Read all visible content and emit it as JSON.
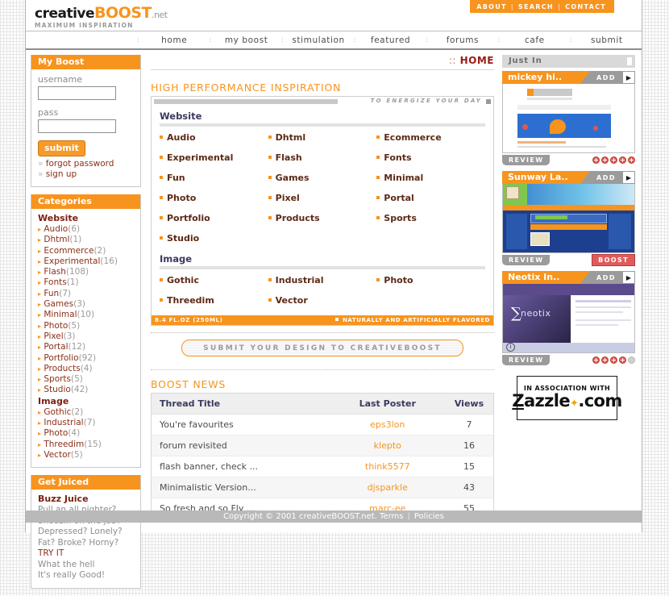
{
  "site": {
    "logo_main": "creative",
    "logo_accent": "BOOST",
    "logo_tld": ".net",
    "logo_sub": "MAXIMUM INSPIRATION"
  },
  "topnav": {
    "items": [
      "ABOUT",
      "SEARCH",
      "CONTACT"
    ],
    "separator": "|"
  },
  "mainnav": {
    "items": [
      "home",
      "my boost",
      "stimulation",
      "featured",
      "forums",
      "cafe",
      "submit"
    ],
    "separator": ":"
  },
  "breadcrumb": {
    "dots": "::",
    "label": "HOME"
  },
  "login_panel": {
    "title": "My Boost",
    "username_label": "username",
    "username_value": "",
    "username_placeholder": "",
    "pass_label": "pass",
    "pass_value": "",
    "pass_placeholder": "",
    "submit_label": "submit",
    "links": [
      {
        "chev": "»",
        "label": "forgot password"
      },
      {
        "chev": "»",
        "label": "sign up"
      }
    ]
  },
  "categories_panel": {
    "title": "Categories",
    "groups": [
      {
        "name": "Website",
        "items": [
          {
            "label": "Audio",
            "count": "(6)"
          },
          {
            "label": "Dhtml",
            "count": "(1)"
          },
          {
            "label": "Ecommerce",
            "count": "(2)"
          },
          {
            "label": "Experimental",
            "count": "(16)"
          },
          {
            "label": "Flash",
            "count": "(108)"
          },
          {
            "label": "Fonts",
            "count": "(1)"
          },
          {
            "label": "Fun",
            "count": "(7)"
          },
          {
            "label": "Games",
            "count": "(3)"
          },
          {
            "label": "Minimal",
            "count": "(10)"
          },
          {
            "label": "Photo",
            "count": "(5)"
          },
          {
            "label": "Pixel",
            "count": "(3)"
          },
          {
            "label": "Portal",
            "count": "(12)"
          },
          {
            "label": "Portfolio",
            "count": "(92)"
          },
          {
            "label": "Products",
            "count": "(4)"
          },
          {
            "label": "Sports",
            "count": "(5)"
          },
          {
            "label": "Studio",
            "count": "(42)"
          }
        ]
      },
      {
        "name": "Image",
        "items": [
          {
            "label": "Gothic",
            "count": "(2)"
          },
          {
            "label": "Industrial",
            "count": "(7)"
          },
          {
            "label": "Photo",
            "count": "(4)"
          },
          {
            "label": "Threedim",
            "count": "(15)"
          },
          {
            "label": "Vector",
            "count": "(5)"
          }
        ]
      }
    ]
  },
  "juiced_panel": {
    "title": "Get Juiced",
    "brand": "Buzz Juice",
    "lines": [
      "Pull an all nighter?",
      "Snoozin on the job?",
      "Depressed? Lonely?",
      "Fat? Broke? Horny?"
    ],
    "cta": "TRY IT",
    "tail": [
      "What the hell",
      "It's really Good!"
    ]
  },
  "inspiration": {
    "heading": "HIGH PERFORMANCE INSPIRATION",
    "tagline": "TO ENERGIZE YOUR DAY",
    "footer_left": "8.4 FL.OZ (250ML)",
    "footer_right": "NATURALLY AND ARTIFICIALLY FLAVORED",
    "groups": [
      {
        "name": "Website",
        "items": [
          "Audio",
          "Dhtml",
          "Ecommerce",
          "Experimental",
          "Flash",
          "Fonts",
          "Fun",
          "Games",
          "Minimal",
          "Photo",
          "Pixel",
          "Portal",
          "Portfolio",
          "Products",
          "Sports",
          "Studio"
        ]
      },
      {
        "name": "Image",
        "items": [
          "Gothic",
          "Industrial",
          "Photo",
          "Threedim",
          "Vector"
        ]
      }
    ]
  },
  "submit_pill": {
    "label": "SUBMIT YOUR DESIGN TO CREATIVEBOOST"
  },
  "news": {
    "heading": "BOOST NEWS",
    "columns": [
      "Thread Title",
      "Last Poster",
      "Views"
    ],
    "rows": [
      {
        "title": "You're favourites",
        "poster": "eps3lon",
        "views": "7"
      },
      {
        "title": "forum revisited",
        "poster": "klepto",
        "views": "16"
      },
      {
        "title": "flash banner, check ...",
        "poster": "think5577",
        "views": "15"
      },
      {
        "title": "Minimalistic Version...",
        "poster": "djsparkle",
        "views": "43"
      },
      {
        "title": "So fresh and so Fly ...",
        "poster": "marc-ee",
        "views": "55"
      }
    ]
  },
  "justin": {
    "title": "Just In",
    "add_label": "ADD",
    "arrow_glyph": "▶",
    "review_label": "REVIEW",
    "boost_label": "BOOST",
    "cards": [
      {
        "title": "mickey hi..",
        "rating": 5,
        "rating_max": 5,
        "has_boost": false
      },
      {
        "title": "Sunway La..",
        "rating": 0,
        "rating_max": 0,
        "has_boost": true
      },
      {
        "title": "Neotix In..",
        "rating": 4,
        "rating_max": 5,
        "has_boost": false
      }
    ]
  },
  "zazzle": {
    "top": "IN ASSOCIATION WITH",
    "z": "Z",
    "name": "azzle",
    "suffix": ".com"
  },
  "footer": {
    "copyright": "Copyright © 2001 creativeBOOST.net. Terms",
    "bar": "|",
    "policies": "Policies"
  },
  "colors": {
    "accent_orange": "#f7941e",
    "dark_red": "#9b1b12",
    "gray": "#9b9b9b",
    "boost_red": "#e05c5c"
  }
}
